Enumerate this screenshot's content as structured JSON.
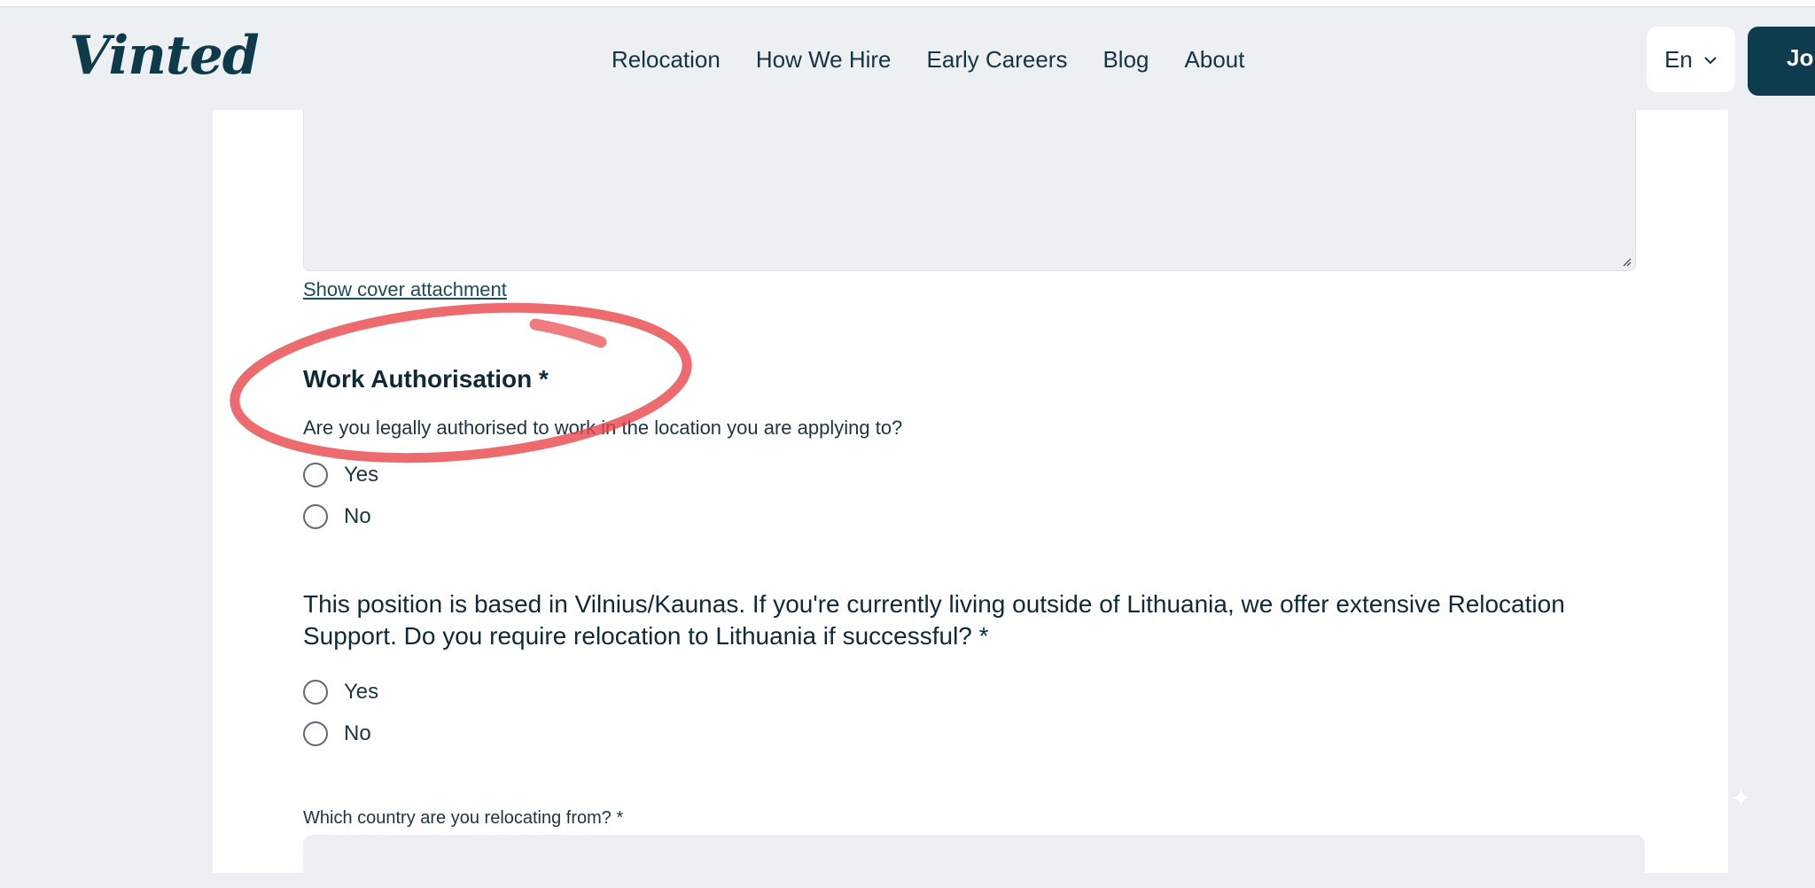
{
  "header": {
    "logo": "Vinted",
    "nav": [
      "Relocation",
      "How We Hire",
      "Early Careers",
      "Blog",
      "About"
    ],
    "language": "En",
    "join_label": "Jo"
  },
  "form": {
    "cover_link": "Show cover attachment",
    "work_auth": {
      "title": "Work Authorisation *",
      "question": "Are you legally authorised to work in the location you are applying to?",
      "options": [
        "Yes",
        "No"
      ]
    },
    "relocation": {
      "question": "This position is based in Vilnius/Kaunas. If you're currently living outside of Lithuania, we offer extensive Relocation Support. Do you require relocation to Lithuania if successful? *",
      "options": [
        "Yes",
        "No"
      ]
    },
    "country": {
      "label": "Which country are you relocating from? *",
      "value": ""
    }
  },
  "colors": {
    "accent": "#0d3c4e",
    "annotation": "#e8464a",
    "page_bg": "#edf0f3"
  }
}
